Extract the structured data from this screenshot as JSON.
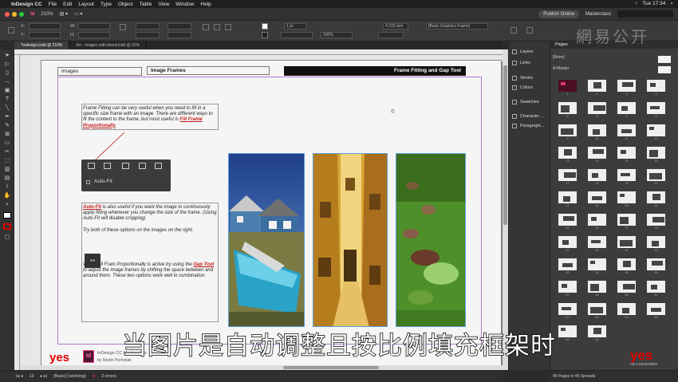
{
  "menubar": {
    "app_name": "InDesign CC",
    "items": [
      "File",
      "Edit",
      "Layout",
      "Type",
      "Object",
      "Table",
      "View",
      "Window",
      "Help"
    ],
    "clock": "Tue 17:34"
  },
  "appbar": {
    "zoom": "210%",
    "publish_label": "Publish Online",
    "workspace": "Masterclass"
  },
  "control_panel": {
    "x_label": "X:",
    "y_label": "Y:",
    "w_label": "W:",
    "h_label": "H:",
    "stroke_weight": "1 pt",
    "opacity": "100%",
    "gap_value": "4.233 mm",
    "object_style": "[Basic Graphics Frame]"
  },
  "document_tabs": [
    {
      "label": "*Indesign.indd @ 210%"
    },
    {
      "label": "Art - Images with bleed.indd @ 25%"
    }
  ],
  "page": {
    "header_left": "Images",
    "header_mid": "Image Frames",
    "header_right": "Frame Fitting and Gap Tool",
    "frame_fitting": {
      "before": "Frame Fitting can be very useful when you need to fill in a specific size frame with an image. There are different ways to fit the content to the frame, but most useful is ",
      "highlight": "Fill Frame Proportionally",
      "after": "."
    },
    "autofit_label": "Auto-Fit",
    "autofit_text": {
      "highlight": "Auto-Fit",
      "after": " is also useful if you want the image to continuously apply fitting whenever you change the size of the frame. (Using Auto-Fit will disable cropping)"
    },
    "try_text": "Try both of these options on the images on the right.",
    "gap_text": {
      "before": "When Fill Fram Proportionally is active try using the ",
      "highlight": "Gap Tool",
      "after": " to adjust the image frames by shifting the space between and around them. These two options work well in combination."
    },
    "brand_text": "yes",
    "brand_sub": "I'M A DESIGNER",
    "id_badge": "Id",
    "id_title": "InDesign CC Masterclass",
    "id_author": "by Martin Perhiniak"
  },
  "status_bar": {
    "page_number": "13",
    "style": "[Basic] (working)",
    "errors": "2 errors"
  },
  "panel_dock": [
    {
      "label": "Layers",
      "icon": "layers-icon"
    },
    {
      "label": "Links",
      "icon": "links-icon"
    },
    {
      "label": "Stroke",
      "icon": "stroke-icon"
    },
    {
      "label": "Colour",
      "icon": "colour-icon"
    },
    {
      "label": "Swatches",
      "icon": "swatches-icon"
    },
    {
      "label": "Character ...",
      "icon": "character-icon"
    },
    {
      "label": "Paragraph...",
      "icon": "paragraph-icon"
    }
  ],
  "pages_panel": {
    "tab": "Pages",
    "none": "[None]",
    "a_master": "A-Master",
    "page_numbers": [
      "1",
      "2",
      "3",
      "4",
      "5",
      "6",
      "7",
      "8",
      "9",
      "10",
      "11",
      "12",
      "13",
      "14",
      "15",
      "16",
      "17",
      "18",
      "19",
      "20",
      "21",
      "22",
      "23",
      "24",
      "25",
      "26",
      "27",
      "28",
      "29",
      "30",
      "31",
      "32",
      "33",
      "34",
      "35",
      "36",
      "37",
      "38",
      "39",
      "40",
      "41",
      "42",
      "43",
      "44",
      "45",
      "46"
    ],
    "footer": "46 Pages in 46 Spreads"
  },
  "subtitle": "当图片是自动调整且按比例填充框架时",
  "watermark": "網易公开",
  "colors": {
    "accent_red": "#c01a1a",
    "frame_blue": "#5a9ed6",
    "margin_purple": "#b07ad0",
    "brand_red": "#e30000",
    "id_pink": "#ff3c8e"
  }
}
